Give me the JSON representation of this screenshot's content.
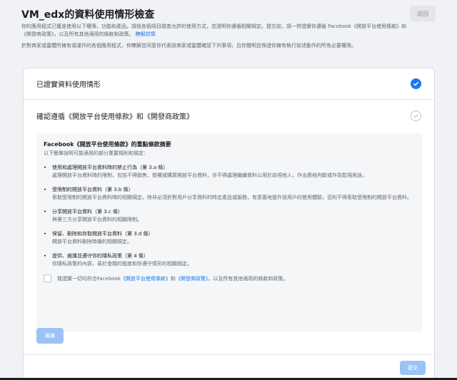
{
  "header": {
    "title": "VM_edx的資料使用情形檢查",
    "back_label": "返回"
  },
  "intro": {
    "line1": "你的應用程式已獲准使用以下權限、功能和產品。請就各個項目檢查允許的使用方式，並證明你遵循相關規定。提交前，請一併證實你遵循 Facebook《開放平台使用條款》和《開發商政策》，以及所有其他適用的條款和政策。",
    "learn_more": "瞭解詳情",
    "line2": "針對商家或靈體所擁有或運作的各個應用程式，你瞭解並同意你代表該商家或靈體確認下列事項，且你聲明並保證你擁有執行前述動作的所有必要權限。"
  },
  "steps": [
    {
      "label": "已證實資料使用情形",
      "status": "completed"
    },
    {
      "label": "確認遵循《開放平台使用條款》和《開發商政策》",
      "status": "pending"
    }
  ],
  "summary": {
    "title": "Facebook《開放平台使用條款》的重點條款摘要",
    "subtitle": "以下簡單說明可能適用的部分重要規則和規定：",
    "items": [
      {
        "title": "使用和處理開放平台資料時的禁止行為（第 3.a 條）",
        "desc": "處理開放平台資料時的限制，包括不得銷售、授權或購買開放平台資料，亦不得處理繼續資料以用於歧視他人，作出資格判斷或作為監視用途。"
      },
      {
        "title": "受限制的開放平台資料（第 3.b 條）",
        "desc": "索取受限制的開放平台資料時的相關規定，除非必須針對用戶分享資料的特定產品或服務，有意義地提升該用戶的使用體驗，否則不得索取受限制的開放平台資料。"
      },
      {
        "title": "分享開放平台資料（第 3.c 條）",
        "desc": "與第三方分享開放平台資料的相關限制。"
      },
      {
        "title": "保留、刪除和存取開放平台資料（第 3.d 條）",
        "desc": "開放平台資料刪除時機的相關規定。"
      },
      {
        "title": "提供、維護並遵守你的隱私政策（第 4 條）",
        "desc": "你隱私政策的內容，易於查閱的程度和你遵守情形的相關規定。"
      }
    ],
    "agree_prefix": "我證實一切均符合Facebook",
    "agree_link1": "《開放平台使用條款》",
    "agree_mid": "和",
    "agree_link2": "《開發商政策》",
    "agree_suffix": "，以及所有其他適用的條款和政策。"
  },
  "buttons": {
    "continue_label": "繼續",
    "submit_label": "提交"
  },
  "colors": {
    "accent": "#1877f2",
    "disabled_button": "#9cc3f5"
  }
}
